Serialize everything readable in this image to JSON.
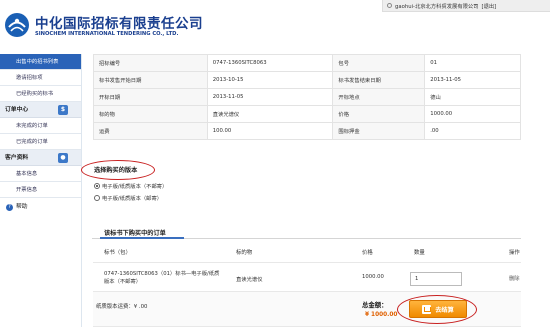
{
  "header": {
    "company_cn": "中化国际招标有限责任公司",
    "company_en": "SINOCHEM INTERNATIONAL TENDERING CO., LTD.",
    "user_info": "gaohui-北京北方科贸发展有限公司",
    "logout": "[退出]"
  },
  "sidebar": {
    "items_top": [
      {
        "label": "出售中的招书列表"
      },
      {
        "label": "邀请招标项"
      },
      {
        "label": "已经购买的标书"
      }
    ],
    "order_center": {
      "title": "订单中心",
      "items": [
        {
          "label": "未完成的订单"
        },
        {
          "label": "已完成的订单"
        }
      ]
    },
    "customer": {
      "title": "客户资料",
      "items": [
        {
          "label": "基本信息"
        },
        {
          "label": "开票信息"
        }
      ]
    },
    "help": "帮助"
  },
  "info": {
    "rows": [
      [
        "招标编号",
        "0747-1360SITC8063",
        "包号",
        "01"
      ],
      [
        "标书发售开始日期",
        "2013-10-15",
        "标书发售结束日期",
        "2013-11-05"
      ],
      [
        "开标日期",
        "2013-11-05",
        "开标地点",
        "德山"
      ],
      [
        "标的物",
        "直读光谱仪",
        "价格",
        "1000.00"
      ],
      [
        "运费",
        "100.00",
        "围标押金",
        ".00"
      ]
    ]
  },
  "version": {
    "title": "选择购买的版本",
    "options": [
      "电子版/纸质版本（不邮寄）",
      "电子版/纸质版本（邮寄）"
    ]
  },
  "order": {
    "title": "该标书下购买中的订单",
    "headers": {
      "code": "标书（包）",
      "item": "标的物",
      "price": "价格",
      "qty": "数量",
      "op": "操作"
    },
    "row": {
      "code": "0747-1360SITC8063（01）标书—电子版/纸质版本（不邮寄）",
      "item": "直读光谱仪",
      "price": "1000.00",
      "qty": "1",
      "op": "删除"
    },
    "shipping_fee": "纸质版本运费：¥ .00",
    "total_label": "总金额：",
    "total_value": "¥ 1000.00",
    "checkout": "去结算"
  },
  "colors": {
    "brand": "#1a3f8f",
    "accent": "#2a63b8",
    "checkout": "#f08a00",
    "highlight": "#c82020"
  }
}
